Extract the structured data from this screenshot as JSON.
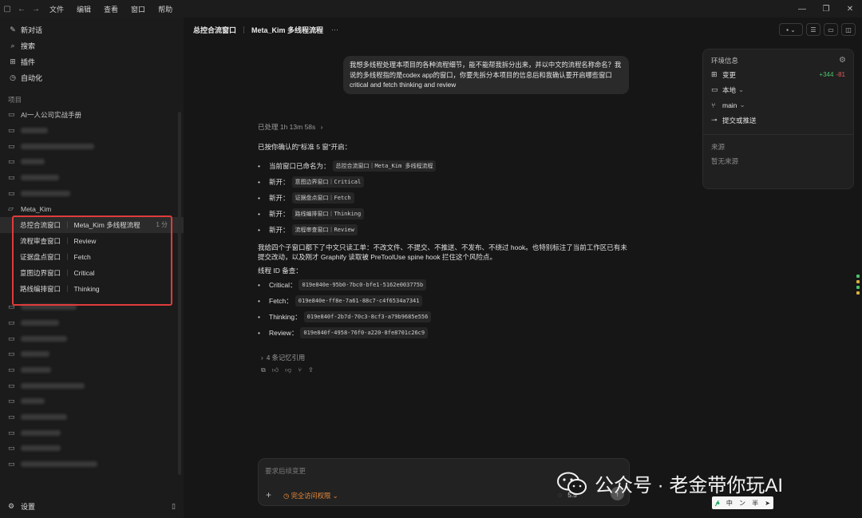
{
  "menu": [
    "文件",
    "编辑",
    "查看",
    "窗口",
    "帮助"
  ],
  "sidebar": {
    "nav": [
      {
        "icon": "new-chat-icon",
        "label": "新对话"
      },
      {
        "icon": "search-icon",
        "label": "搜索"
      },
      {
        "icon": "plugin-icon",
        "label": "插件"
      },
      {
        "icon": "automation-icon",
        "label": "自动化"
      }
    ],
    "projects_label": "项目",
    "first_project": "AI一人公司实战手册",
    "meta_project": "Meta_Kim",
    "threads": [
      {
        "a": "总控合流窗口",
        "b": "Meta_Kim 多线程流程",
        "time": "1 分",
        "active": true
      },
      {
        "a": "流程审查窗口",
        "b": "Review"
      },
      {
        "a": "证据盘点窗口",
        "b": "Fetch"
      },
      {
        "a": "意图边界窗口",
        "b": "Critical"
      },
      {
        "a": "路线编排窗口",
        "b": "Thinking"
      }
    ],
    "settings_label": "设置"
  },
  "main": {
    "title_a": "总控合流窗口",
    "title_b": "Meta_Kim 多线程流程",
    "user_message": "我想多线程处理本项目的各种流程细节，能不能帮我拆分出来，并以中文的流程名称命名？我说的多线程指的是codex app的窗口，你要先拆分本项目的信息后和我确认要开启哪些窗口 critical and fetch thinking and review",
    "processed": "已处理 1h 13m 58s",
    "intro": "已按你确认的“标准 5 窗”开启：",
    "window_list": [
      {
        "prefix": "当前窗口已命名为：",
        "code": "总控合流窗口｜Meta_Kim 多线程流程"
      },
      {
        "prefix": "新开：",
        "code": "意图边界窗口｜Critical"
      },
      {
        "prefix": "新开：",
        "code": "证据盘点窗口｜Fetch"
      },
      {
        "prefix": "新开：",
        "code": "路线编排窗口｜Thinking"
      },
      {
        "prefix": "新开：",
        "code": "流程审查窗口｜Review"
      }
    ],
    "paragraph": "我给四个子窗口都下了中文只读工单：不改文件、不提交、不推送、不发布、不绕过 hook。也特别标注了当前工作区已有未提交改动，以及刚才 Graphify 读取被 PreToolUse spine hook 拦住这个风险点。",
    "thread_id_heading": "线程 ID 备查：",
    "thread_ids": [
      {
        "label": "Critical：",
        "id": "019e840e-95b0-7bc0-bfe1-5162e003775b"
      },
      {
        "label": "Fetch：",
        "id": "019e840e-ff8e-7a61-88c7-c4f6534a7341"
      },
      {
        "label": "Thinking：",
        "id": "019e840f-2b7d-70c3-8cf3-a79b9685e556"
      },
      {
        "label": "Review：",
        "id": "019e840f-4958-76f0-a220-8fe8701c26c9"
      }
    ],
    "memory": "4 条记忆引用",
    "composer_placeholder": "要求后续变更",
    "access_label": "完全访问权限",
    "model": "5.5"
  },
  "env": {
    "title": "环境信息",
    "changes_label": "变更",
    "added": "+344",
    "removed": "-81",
    "local_label": "本地",
    "branch": "main",
    "commit_label": "提交或推送",
    "source_title": "来源",
    "source_empty": "暂无来源"
  },
  "watermark": "公众号 · 老金带你玩AI",
  "ime": {
    "a": "中",
    "b": "ン",
    "c": "半"
  }
}
